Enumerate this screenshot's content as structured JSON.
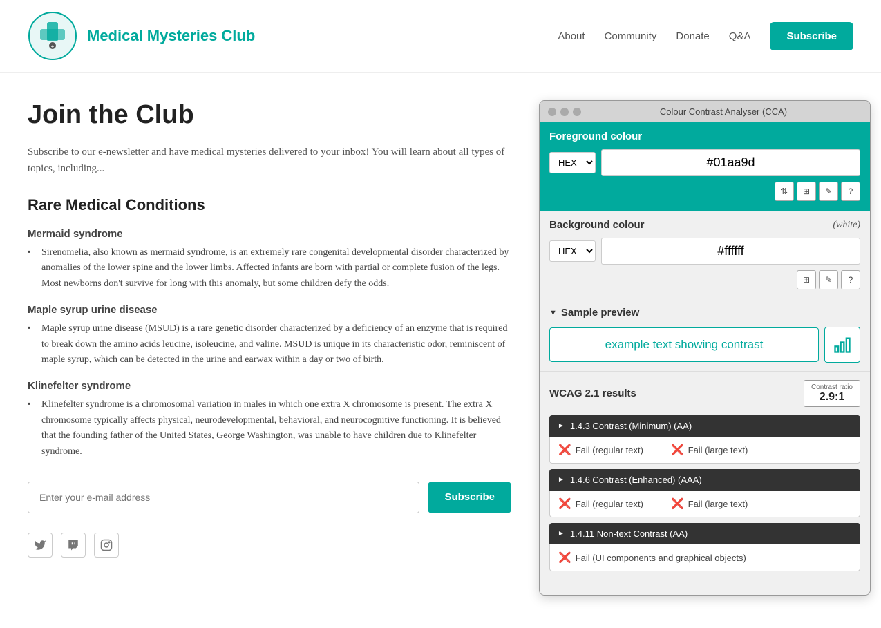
{
  "site": {
    "title": "Medical Mysteries Club",
    "logo_alt": "Medical Mysteries Club Logo"
  },
  "nav": {
    "about": "About",
    "community": "Community",
    "donate": "Donate",
    "qa": "Q&A",
    "subscribe": "Subscribe"
  },
  "page": {
    "heading": "Join the Club",
    "intro": "Subscribe to our e-newsletter and have medical mysteries delivered to your inbox! You will learn about all types of topics, including...",
    "section_title": "Rare Medical Conditions"
  },
  "conditions": [
    {
      "name": "Mermaid syndrome",
      "description": "Sirenomelia, also known as mermaid syndrome, is an extremely rare congenital developmental disorder characterized by anomalies of the lower spine and the lower limbs. Affected infants are born with partial or complete fusion of the legs. Most newborns don't survive for long with this anomaly, but some children defy the odds."
    },
    {
      "name": "Maple syrup urine disease",
      "description": "Maple syrup urine disease (MSUD) is a rare genetic disorder characterized by a deficiency of an enzyme that is required to break down the amino acids leucine, isoleucine, and valine. MSUD is unique in its characteristic odor, reminiscent of maple syrup, which can be detected in the urine and earwax within a day or two of birth."
    },
    {
      "name": "Klinefelter syndrome",
      "description": "Klinefelter syndrome is a chromosomal variation in males in which one extra X chromosome is present. The extra X chromosome typically affects physical, neurodevelopmental, behavioral, and neurocognitive functioning. It is believed that the founding father of the United States, George Washington, was unable to have children due to Klinefelter syndrome."
    }
  ],
  "email": {
    "placeholder": "Enter your e-mail address",
    "subscribe_label": "Subscribe"
  },
  "cca": {
    "title": "Colour Contrast Analyser (CCA)",
    "fg_label": "Foreground colour",
    "fg_format": "HEX",
    "fg_value": "#01aa9d",
    "bg_label": "Background colour",
    "bg_color_name": "(white)",
    "bg_format": "HEX",
    "bg_value": "#ffffff",
    "sample_preview_label": "Sample preview",
    "sample_text": "example text showing contrast",
    "wcag_label": "WCAG 2.1 results",
    "contrast_ratio_label": "Contrast ratio",
    "contrast_ratio_value": "2.9:1",
    "rules": [
      {
        "id": "1_4_3",
        "label": "1.4.3 Contrast (Minimum) (AA)",
        "results": [
          {
            "label": "Fail (regular text)",
            "status": "fail"
          },
          {
            "label": "Fail (large text)",
            "status": "fail"
          }
        ]
      },
      {
        "id": "1_4_6",
        "label": "1.4.6 Contrast (Enhanced) (AAA)",
        "results": [
          {
            "label": "Fail (regular text)",
            "status": "fail"
          },
          {
            "label": "Fail (large text)",
            "status": "fail"
          }
        ]
      },
      {
        "id": "1_4_11",
        "label": "1.4.11 Non-text Contrast (AA)",
        "results": [
          {
            "label": "Fail (UI components and graphical objects)",
            "status": "fail"
          }
        ]
      }
    ]
  }
}
